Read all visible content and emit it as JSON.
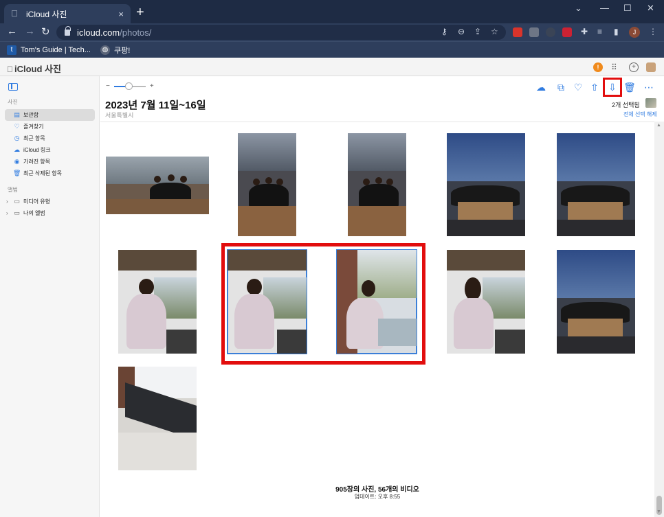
{
  "browser": {
    "tab_title": "iCloud 사진",
    "tab_close": "×",
    "new_tab": "+",
    "url_host": "icloud.com",
    "url_path": "/photos/",
    "bookmarks": [
      {
        "label": "Tom's Guide | Tech...",
        "icon": "t",
        "color": "#1f5aa6"
      },
      {
        "label": "쿠팡!",
        "icon": "◍",
        "color": "#5a6478"
      }
    ],
    "profile_initial": "J"
  },
  "app": {
    "title": "iCloud 사진"
  },
  "sidebar": {
    "section_library": "사진",
    "items": [
      {
        "label": "보관함",
        "icon": "▤"
      },
      {
        "label": "즐겨찾기",
        "icon": "♡"
      },
      {
        "label": "최근 항목",
        "icon": "◷"
      },
      {
        "label": "iCloud 링크",
        "icon": "☁"
      },
      {
        "label": "가려진 항목",
        "icon": "◉"
      },
      {
        "label": "최근 삭제된 항목",
        "icon": "🗑"
      }
    ],
    "section_albums": "앨범",
    "album_groups": [
      {
        "label": "미디어 유형"
      },
      {
        "label": "나의 앨범"
      }
    ]
  },
  "main": {
    "zoom_minus": "−",
    "zoom_plus": "+",
    "zoom_level": 0.45,
    "title": "2023년 7월 11일~16일",
    "subtitle": "서울특별시",
    "selected_count": "2개 선택됨",
    "deselect_all": "전체 선택 해제",
    "footer_counts": "905장의 사진, 56개의 비디오",
    "footer_updated": "업데이트: 오후 8:55"
  },
  "photos": [
    {
      "kind": "group-wide",
      "selected": false
    },
    {
      "kind": "group-tall",
      "selected": false
    },
    {
      "kind": "group-tall",
      "selected": false
    },
    {
      "kind": "dinner",
      "selected": false
    },
    {
      "kind": "dinner",
      "selected": false
    },
    {
      "kind": "woman-river",
      "selected": false
    },
    {
      "kind": "woman-river",
      "selected": true
    },
    {
      "kind": "woman-eating",
      "selected": true
    },
    {
      "kind": "woman-back",
      "selected": false
    },
    {
      "kind": "dinner",
      "selected": false
    },
    {
      "kind": "bench",
      "selected": false
    }
  ],
  "colors": {
    "accent": "#2f7be0",
    "highlight": "#e20d0d",
    "chrome_dark": "#1e2b44",
    "chrome": "#2e3e5c"
  }
}
